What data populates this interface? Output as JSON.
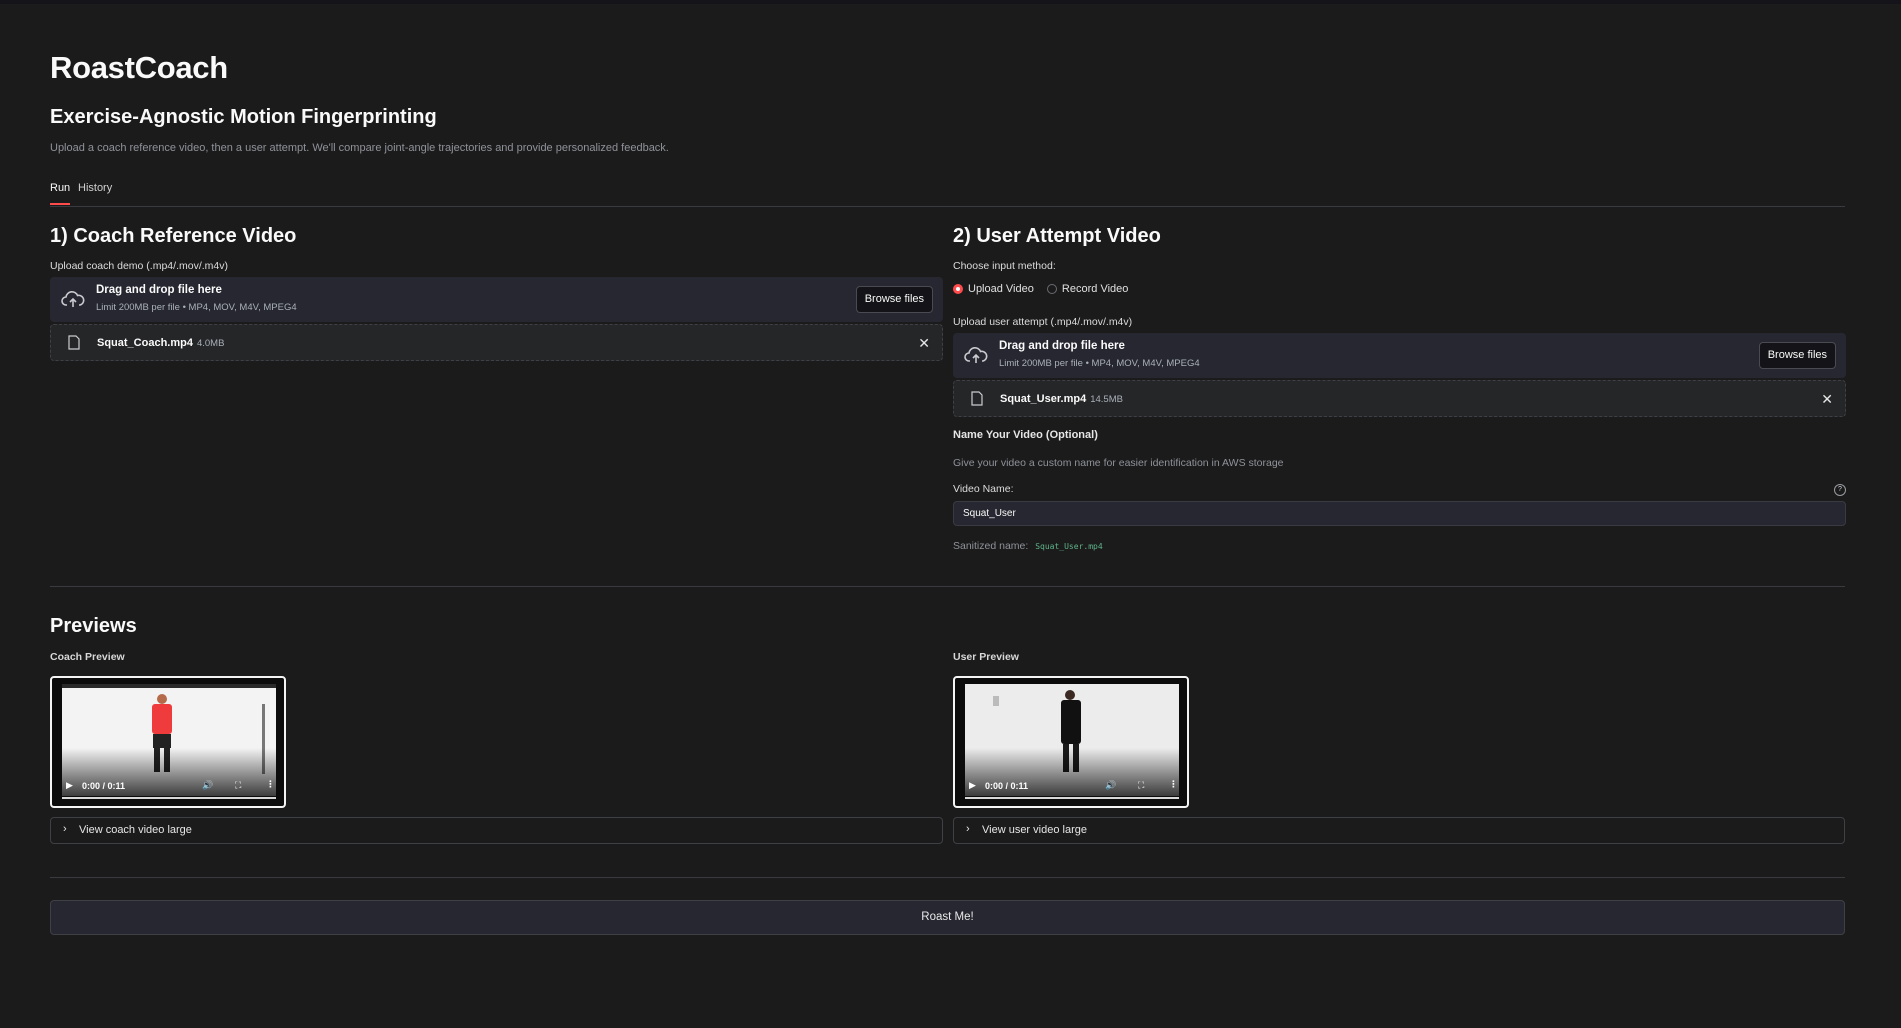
{
  "app": {
    "title": "RoastCoach",
    "subtitle": "Exercise-Agnostic Motion Fingerprinting",
    "description": "Upload a coach reference video, then a user attempt. We'll compare joint-angle trajectories and provide personalized feedback."
  },
  "tabs": [
    {
      "label": "Run",
      "active": true
    },
    {
      "label": "History",
      "active": false
    }
  ],
  "coach": {
    "heading": "1) Coach Reference Video",
    "upload_label": "Upload coach demo (.mp4/.mov/.m4v)",
    "dropzone_title": "Drag and drop file here",
    "dropzone_limit": "Limit 200MB per file • MP4, MOV, M4V, MPEG4",
    "browse_label": "Browse files",
    "file_name": "Squat_Coach.mp4",
    "file_size": "4.0MB"
  },
  "user": {
    "heading": "2) User Attempt Video",
    "method_label": "Choose input method:",
    "methods": [
      {
        "label": "Upload Video",
        "selected": true
      },
      {
        "label": "Record Video",
        "selected": false
      }
    ],
    "upload_label": "Upload user attempt (.mp4/.mov/.m4v)",
    "dropzone_title": "Drag and drop file here",
    "dropzone_limit": "Limit 200MB per file • MP4, MOV, M4V, MPEG4",
    "browse_label": "Browse files",
    "file_name": "Squat_User.mp4",
    "file_size": "14.5MB",
    "name_section_title": "Name Your Video (Optional)",
    "name_section_help": "Give your video a custom name for easier identification in AWS storage",
    "video_name_label": "Video Name:",
    "video_name_value": "Squat_User",
    "sanitized_label": "Sanitized name:",
    "sanitized_value": "Squat_User.mp4"
  },
  "previews": {
    "heading": "Previews",
    "coach_label": "Coach Preview",
    "user_label": "User Preview",
    "coach_time": "0:00 / 0:11",
    "user_time": "0:00 / 0:11",
    "coach_expander": "View coach video large",
    "user_expander": "View user video large"
  },
  "actions": {
    "roast_label": "Roast Me!"
  },
  "colors": {
    "background": "#1b1b1b",
    "accent": "#ff4b4b",
    "panel": "#262730"
  },
  "icons": [
    "cloud-upload-icon",
    "file-icon",
    "close-icon",
    "help-icon",
    "chevron-right-icon",
    "play-icon",
    "volume-icon",
    "fullscreen-icon",
    "more-icon"
  ]
}
